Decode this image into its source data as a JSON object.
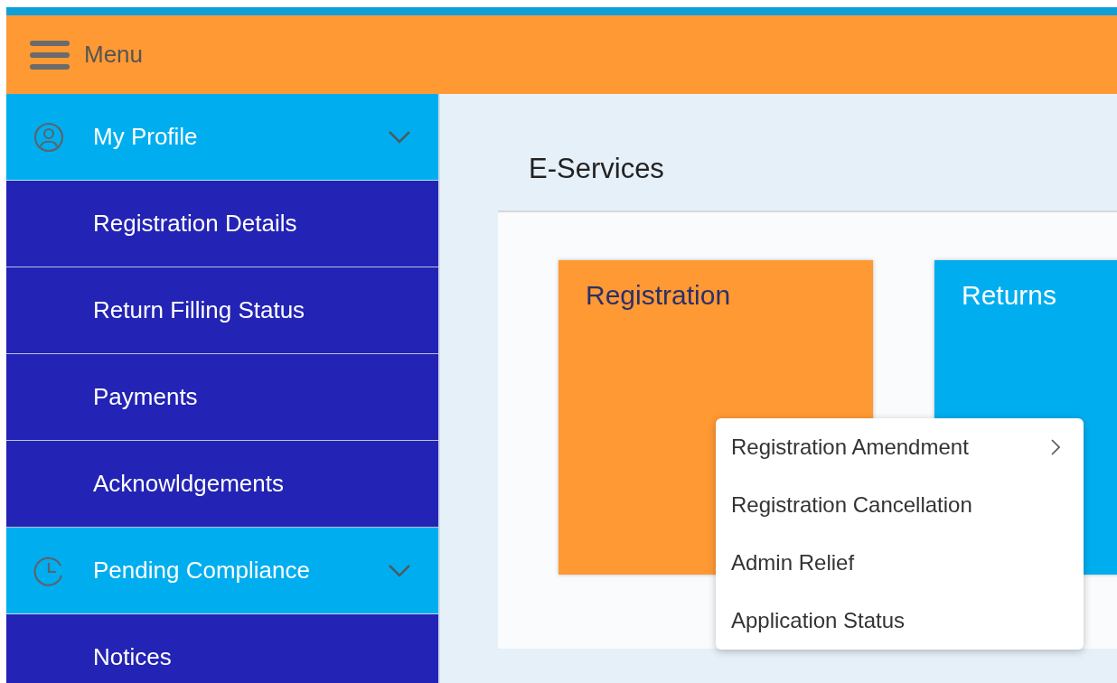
{
  "header": {
    "menu_label": "Menu"
  },
  "sidebar": {
    "groups": [
      {
        "label": "My Profile",
        "kind": "profile",
        "expanded": true,
        "children": [
          {
            "label": "Registration Details"
          },
          {
            "label": "Return Filling Status"
          },
          {
            "label": "Payments"
          },
          {
            "label": "Acknowldgements"
          }
        ]
      },
      {
        "label": "Pending Compliance",
        "kind": "clock",
        "expanded": true,
        "children": [
          {
            "label": "Notices"
          }
        ]
      }
    ]
  },
  "main": {
    "title": "E-Services",
    "tiles": [
      {
        "label": "Registration",
        "color": "#ff9933"
      },
      {
        "label": "Returns",
        "color": "#00aeef"
      }
    ],
    "popup_menu": [
      {
        "label": "Registration Amendment",
        "has_submenu": true
      },
      {
        "label": "Registration Cancellation",
        "has_submenu": false
      },
      {
        "label": "Admin Relief",
        "has_submenu": false
      },
      {
        "label": "Application Status",
        "has_submenu": false
      }
    ]
  }
}
